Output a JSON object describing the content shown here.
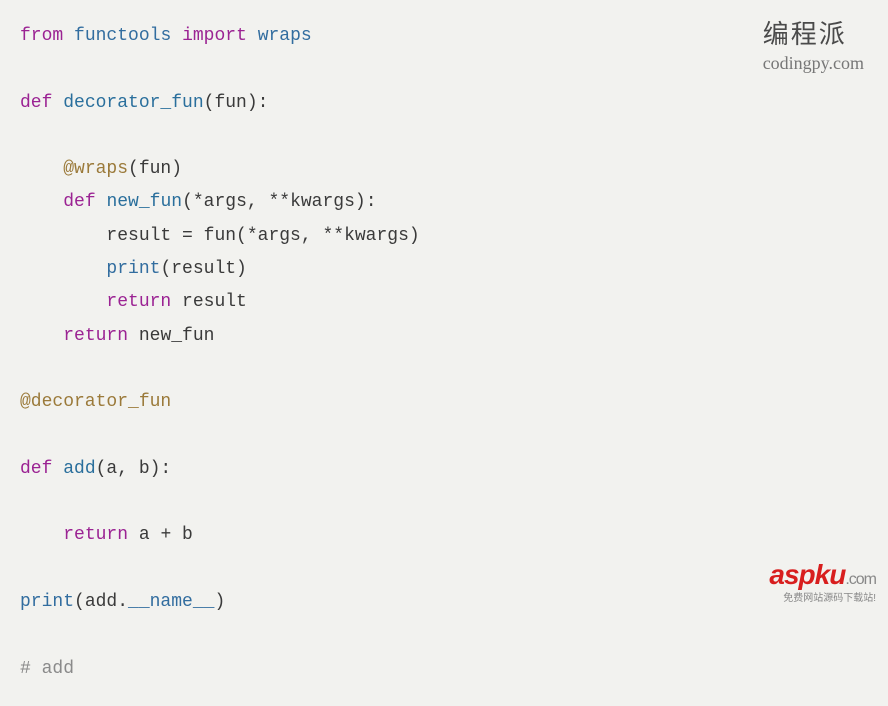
{
  "code": {
    "l1_from": "from",
    "l1_mod": "functools",
    "l1_import": "import",
    "l1_name": "wraps",
    "l3_def": "def",
    "l3_fn": "decorator_fun",
    "l3_params": "(fun):",
    "l5_deco": "@wraps",
    "l5_deco_arg": "(fun)",
    "l6_def": "def",
    "l6_fn": "new_fun",
    "l6_params": "(*args, **kwargs):",
    "l7_lhs": "result",
    "l7_eq": " = ",
    "l7_rhs": "fun(*args, **kwargs)",
    "l8_print": "print",
    "l8_arg": "(result)",
    "l9_return": "return",
    "l9_val": "result",
    "l10_return": "return",
    "l10_val": "new_fun",
    "l12_deco": "@decorator_fun",
    "l14_def": "def",
    "l14_fn": "add",
    "l14_params": "(a, b):",
    "l16_return": "return",
    "l16_val": "a + b",
    "l18_print": "print",
    "l18_open": "(add.",
    "l18_dunder": "__name__",
    "l18_close": ")",
    "l20_comment": "# add"
  },
  "watermark_top": {
    "cn": "编程派",
    "en": "codingpy.com"
  },
  "watermark_bottom": {
    "brand": "aspku",
    "suffix": ".com",
    "tagline": "免费网站源码下载站!"
  }
}
